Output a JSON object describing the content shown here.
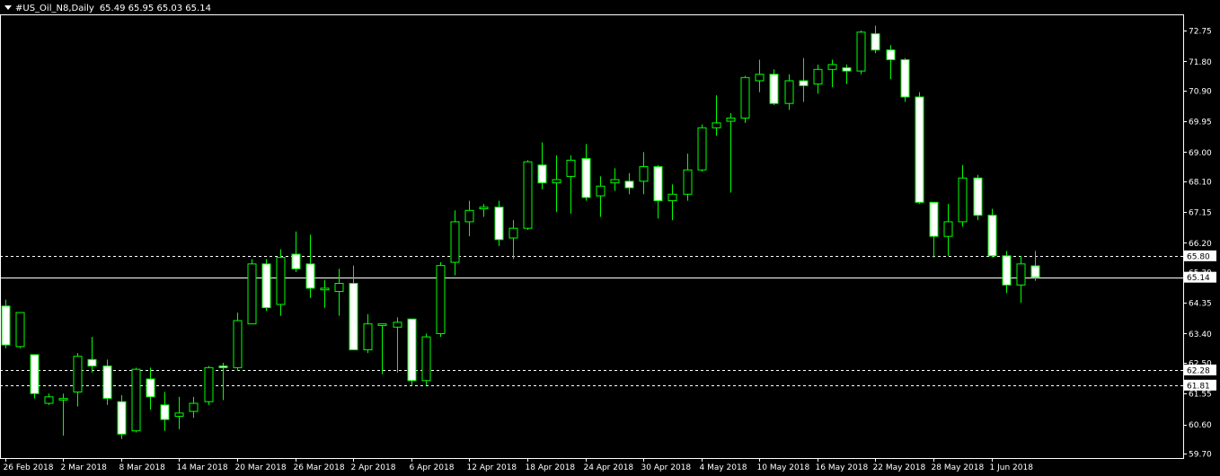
{
  "header": {
    "symbol": "#US_Oil_N8,Daily",
    "open": "65.49",
    "high": "65.95",
    "low": "65.03",
    "close": "65.14"
  },
  "colors": {
    "background": "#000000",
    "bull_fill": "#000000",
    "bear_fill": "#ffffff",
    "wick": "#00ff00",
    "grid_line": "#ffffff",
    "axis_text": "#ffffff",
    "price_tag_bg": "#ffffff",
    "price_tag_text": "#000000"
  },
  "chart_data": {
    "type": "candlestick",
    "title": "#US_Oil_N8,Daily",
    "y_ticks": [
      "72.75",
      "71.80",
      "70.90",
      "69.95",
      "69.00",
      "68.10",
      "67.15",
      "66.20",
      "65.30",
      "64.35",
      "63.40",
      "62.50",
      "61.55",
      "60.60",
      "59.70"
    ],
    "ylim": [
      59.7,
      72.75
    ],
    "x_labels": [
      "26 Feb 2018",
      "2 Mar 2018",
      "8 Mar 2018",
      "14 Mar 2018",
      "20 Mar 2018",
      "26 Mar 2018",
      "2 Apr 2018",
      "6 Apr 2018",
      "12 Apr 2018",
      "18 Apr 2018",
      "24 Apr 2018",
      "30 Apr 2018",
      "4 May 2018",
      "10 May 2018",
      "16 May 2018",
      "22 May 2018",
      "28 May 2018",
      "1 Jun 2018"
    ],
    "horizontal_levels": [
      {
        "value": 65.8,
        "label": "65.80",
        "style": "dashed"
      },
      {
        "value": 65.14,
        "label": "65.14",
        "style": "solid"
      },
      {
        "value": 62.28,
        "label": "62.28",
        "style": "dashed"
      },
      {
        "value": 61.81,
        "label": "61.81",
        "style": "dashed"
      }
    ],
    "candles": [
      {
        "o": 64.25,
        "h": 64.45,
        "l": 62.95,
        "c": 63.05
      },
      {
        "o": 63.0,
        "h": 64.0,
        "l": 62.95,
        "c": 64.05
      },
      {
        "o": 62.75,
        "h": 62.75,
        "l": 61.4,
        "c": 61.55
      },
      {
        "o": 61.25,
        "h": 61.55,
        "l": 61.2,
        "c": 61.45
      },
      {
        "o": 61.35,
        "h": 61.55,
        "l": 60.25,
        "c": 61.4
      },
      {
        "o": 61.6,
        "h": 62.8,
        "l": 61.15,
        "c": 62.7
      },
      {
        "o": 62.6,
        "h": 63.3,
        "l": 62.2,
        "c": 62.4
      },
      {
        "o": 62.4,
        "h": 62.6,
        "l": 61.2,
        "c": 61.4
      },
      {
        "o": 61.3,
        "h": 61.5,
        "l": 60.15,
        "c": 60.3
      },
      {
        "o": 60.4,
        "h": 62.35,
        "l": 60.35,
        "c": 62.3
      },
      {
        "o": 62.0,
        "h": 62.35,
        "l": 61.05,
        "c": 61.45
      },
      {
        "o": 61.2,
        "h": 61.6,
        "l": 60.4,
        "c": 60.75
      },
      {
        "o": 60.85,
        "h": 61.45,
        "l": 60.45,
        "c": 60.95
      },
      {
        "o": 61.0,
        "h": 61.45,
        "l": 60.8,
        "c": 61.25
      },
      {
        "o": 61.3,
        "h": 62.4,
        "l": 61.2,
        "c": 62.35
      },
      {
        "o": 62.4,
        "h": 62.5,
        "l": 61.35,
        "c": 62.35
      },
      {
        "o": 62.35,
        "h": 64.05,
        "l": 62.25,
        "c": 63.8
      },
      {
        "o": 63.7,
        "h": 65.7,
        "l": 63.7,
        "c": 65.55
      },
      {
        "o": 65.55,
        "h": 65.7,
        "l": 64.1,
        "c": 64.2
      },
      {
        "o": 64.3,
        "h": 66.0,
        "l": 63.95,
        "c": 65.75
      },
      {
        "o": 65.85,
        "h": 66.55,
        "l": 65.3,
        "c": 65.4
      },
      {
        "o": 65.55,
        "h": 66.45,
        "l": 64.5,
        "c": 64.8
      },
      {
        "o": 64.75,
        "h": 65.05,
        "l": 64.2,
        "c": 64.8
      },
      {
        "o": 64.7,
        "h": 65.4,
        "l": 63.95,
        "c": 64.95
      },
      {
        "o": 64.95,
        "h": 65.5,
        "l": 62.9,
        "c": 62.9
      },
      {
        "o": 62.9,
        "h": 64.0,
        "l": 62.8,
        "c": 63.7
      },
      {
        "o": 63.65,
        "h": 63.7,
        "l": 62.15,
        "c": 63.7
      },
      {
        "o": 63.6,
        "h": 63.9,
        "l": 62.2,
        "c": 63.75
      },
      {
        "o": 63.85,
        "h": 63.85,
        "l": 61.8,
        "c": 61.95
      },
      {
        "o": 61.95,
        "h": 63.4,
        "l": 61.8,
        "c": 63.3
      },
      {
        "o": 63.4,
        "h": 65.6,
        "l": 63.3,
        "c": 65.5
      },
      {
        "o": 65.6,
        "h": 67.2,
        "l": 65.2,
        "c": 66.85
      },
      {
        "o": 66.85,
        "h": 67.5,
        "l": 66.4,
        "c": 67.2
      },
      {
        "o": 67.25,
        "h": 67.4,
        "l": 67.0,
        "c": 67.3
      },
      {
        "o": 67.3,
        "h": 67.5,
        "l": 66.1,
        "c": 66.3
      },
      {
        "o": 66.35,
        "h": 66.9,
        "l": 65.7,
        "c": 66.65
      },
      {
        "o": 66.65,
        "h": 68.75,
        "l": 66.6,
        "c": 68.7
      },
      {
        "o": 68.6,
        "h": 69.3,
        "l": 67.85,
        "c": 68.05
      },
      {
        "o": 68.05,
        "h": 68.9,
        "l": 67.15,
        "c": 68.15
      },
      {
        "o": 68.25,
        "h": 68.9,
        "l": 67.1,
        "c": 68.75
      },
      {
        "o": 68.8,
        "h": 69.25,
        "l": 67.5,
        "c": 67.6
      },
      {
        "o": 67.65,
        "h": 68.25,
        "l": 67.0,
        "c": 67.95
      },
      {
        "o": 68.05,
        "h": 68.5,
        "l": 67.8,
        "c": 68.15
      },
      {
        "o": 68.1,
        "h": 68.35,
        "l": 67.7,
        "c": 67.9
      },
      {
        "o": 68.1,
        "h": 69.0,
        "l": 67.7,
        "c": 68.55
      },
      {
        "o": 68.55,
        "h": 68.6,
        "l": 66.95,
        "c": 67.5
      },
      {
        "o": 67.5,
        "h": 68.0,
        "l": 66.9,
        "c": 67.7
      },
      {
        "o": 67.7,
        "h": 68.95,
        "l": 67.5,
        "c": 68.45
      },
      {
        "o": 68.45,
        "h": 69.85,
        "l": 68.4,
        "c": 69.75
      },
      {
        "o": 69.75,
        "h": 70.75,
        "l": 69.5,
        "c": 69.9
      },
      {
        "o": 69.95,
        "h": 70.2,
        "l": 67.75,
        "c": 70.05
      },
      {
        "o": 70.05,
        "h": 71.35,
        "l": 69.9,
        "c": 71.3
      },
      {
        "o": 71.2,
        "h": 71.85,
        "l": 70.85,
        "c": 71.4
      },
      {
        "o": 71.4,
        "h": 71.55,
        "l": 70.45,
        "c": 70.5
      },
      {
        "o": 70.5,
        "h": 71.4,
        "l": 70.3,
        "c": 71.2
      },
      {
        "o": 71.2,
        "h": 71.9,
        "l": 70.55,
        "c": 71.05
      },
      {
        "o": 71.1,
        "h": 71.7,
        "l": 70.8,
        "c": 71.55
      },
      {
        "o": 71.55,
        "h": 71.85,
        "l": 71.0,
        "c": 71.7
      },
      {
        "o": 71.6,
        "h": 71.7,
        "l": 71.1,
        "c": 71.5
      },
      {
        "o": 71.5,
        "h": 72.75,
        "l": 71.4,
        "c": 72.7
      },
      {
        "o": 72.65,
        "h": 72.9,
        "l": 72.05,
        "c": 72.15
      },
      {
        "o": 72.15,
        "h": 72.3,
        "l": 71.25,
        "c": 71.85
      },
      {
        "o": 71.85,
        "h": 71.9,
        "l": 70.55,
        "c": 70.7
      },
      {
        "o": 70.7,
        "h": 70.85,
        "l": 67.4,
        "c": 67.45
      },
      {
        "o": 67.45,
        "h": 67.45,
        "l": 65.75,
        "c": 66.4
      },
      {
        "o": 66.4,
        "h": 67.4,
        "l": 65.8,
        "c": 66.85
      },
      {
        "o": 66.85,
        "h": 68.6,
        "l": 66.7,
        "c": 68.2
      },
      {
        "o": 68.2,
        "h": 68.3,
        "l": 66.9,
        "c": 67.05
      },
      {
        "o": 67.05,
        "h": 67.25,
        "l": 65.75,
        "c": 65.8
      },
      {
        "o": 65.8,
        "h": 65.95,
        "l": 64.65,
        "c": 64.9
      },
      {
        "o": 64.9,
        "h": 65.8,
        "l": 64.35,
        "c": 65.55
      },
      {
        "o": 65.49,
        "h": 65.95,
        "l": 65.03,
        "c": 65.14
      }
    ]
  }
}
